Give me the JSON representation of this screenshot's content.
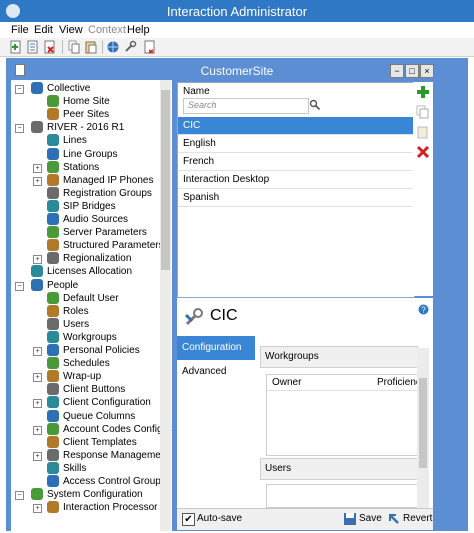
{
  "window": {
    "title": "Interaction Administrator"
  },
  "menu": [
    "File",
    "Edit",
    "View",
    "Context",
    "Help"
  ],
  "toolbar": {
    "icons": [
      "new-icon",
      "properties-icon",
      "delete-icon",
      "copy-icon",
      "paste-icon",
      "connect-icon",
      "wrench-icon",
      "export-icon"
    ]
  },
  "subwindow": {
    "title": "CustomerSite",
    "buttons": [
      "−",
      "□",
      "×"
    ]
  },
  "tree": {
    "items": [
      {
        "label": "Collective",
        "level": 0,
        "expand": "−"
      },
      {
        "label": "Home Site",
        "level": 1,
        "expand": ""
      },
      {
        "label": "Peer Sites",
        "level": 1,
        "expand": ""
      },
      {
        "label": "RIVER - 2016 R1",
        "level": 0,
        "expand": "−"
      },
      {
        "label": "Lines",
        "level": 1,
        "expand": ""
      },
      {
        "label": "Line Groups",
        "level": 1,
        "expand": ""
      },
      {
        "label": "Stations",
        "level": 1,
        "expand": "+"
      },
      {
        "label": "Managed IP Phones",
        "level": 1,
        "expand": "+"
      },
      {
        "label": "Registration Groups",
        "level": 1,
        "expand": ""
      },
      {
        "label": "SIP Bridges",
        "level": 1,
        "expand": ""
      },
      {
        "label": "Audio Sources",
        "level": 1,
        "expand": ""
      },
      {
        "label": "Server Parameters",
        "level": 1,
        "expand": ""
      },
      {
        "label": "Structured Parameters",
        "level": 1,
        "expand": ""
      },
      {
        "label": "Regionalization",
        "level": 1,
        "expand": "+"
      },
      {
        "label": "Licenses Allocation",
        "level": 0,
        "expand": ""
      },
      {
        "label": "People",
        "level": 0,
        "expand": "−"
      },
      {
        "label": "Default User",
        "level": 1,
        "expand": ""
      },
      {
        "label": "Roles",
        "level": 1,
        "expand": ""
      },
      {
        "label": "Users",
        "level": 1,
        "expand": ""
      },
      {
        "label": "Workgroups",
        "level": 1,
        "expand": ""
      },
      {
        "label": "Personal Policies",
        "level": 1,
        "expand": "+"
      },
      {
        "label": "Schedules",
        "level": 1,
        "expand": ""
      },
      {
        "label": "Wrap-up",
        "level": 1,
        "expand": "+"
      },
      {
        "label": "Client Buttons",
        "level": 1,
        "expand": ""
      },
      {
        "label": "Client Configuration",
        "level": 1,
        "expand": "+"
      },
      {
        "label": "Queue Columns",
        "level": 1,
        "expand": ""
      },
      {
        "label": "Account Codes Configura",
        "level": 1,
        "expand": "+"
      },
      {
        "label": "Client Templates",
        "level": 1,
        "expand": ""
      },
      {
        "label": "Response Management",
        "level": 1,
        "expand": "+"
      },
      {
        "label": "Skills",
        "level": 1,
        "expand": ""
      },
      {
        "label": "Access Control Groups",
        "level": 1,
        "expand": ""
      },
      {
        "label": "System Configuration",
        "level": 0,
        "expand": "−"
      },
      {
        "label": "Interaction Processor",
        "level": 1,
        "expand": "+"
      }
    ]
  },
  "list": {
    "header": "Name",
    "search_placeholder": "Search",
    "items": [
      "CIC",
      "English",
      "French",
      "Interaction Desktop",
      "Spanish"
    ],
    "selected": 0
  },
  "detail": {
    "title": "CIC",
    "tabs": [
      "Configuration",
      "Advanced"
    ],
    "active_tab": 0,
    "sections": [
      {
        "title": "Workgroups",
        "columns": [
          "Owner",
          "Proficiency"
        ]
      },
      {
        "title": "Users",
        "columns": []
      }
    ],
    "autosave_label": "Auto-save",
    "autosave_checked": true,
    "save_label": "Save",
    "revert_label": "Revert"
  },
  "colors": {
    "titlebar": "#2e78c6",
    "frame": "#5b8ed3",
    "selection": "#3a86d6",
    "tab_active": "#3a86d6"
  }
}
